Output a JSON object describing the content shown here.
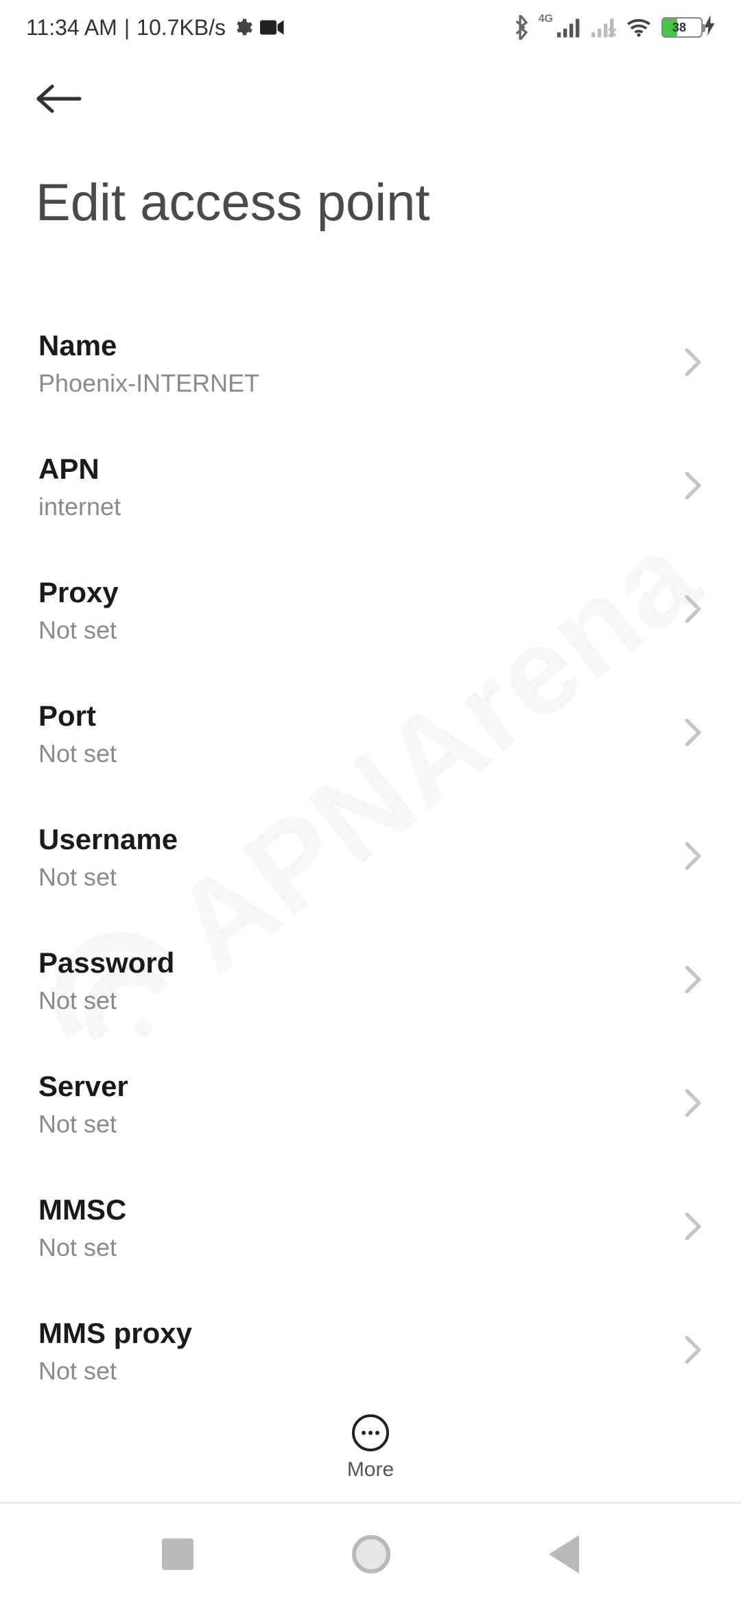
{
  "status_bar": {
    "time": "11:34 AM",
    "separator": "|",
    "net_speed": "10.7KB/s",
    "icons": {
      "gear": "gear-icon",
      "camera": "camera-icon",
      "bluetooth": "bluetooth-icon",
      "net_badge": "4G",
      "signal1": "signal-strong-icon",
      "signal2": "signal-none-icon",
      "wifi": "wifi-icon"
    },
    "battery": {
      "level_text": "38",
      "level_pct": 38,
      "charging": true
    }
  },
  "nav": {
    "back": "back"
  },
  "page": {
    "title": "Edit access point"
  },
  "settings": [
    {
      "key": "name",
      "label": "Name",
      "value": "Phoenix-INTERNET"
    },
    {
      "key": "apn",
      "label": "APN",
      "value": "internet"
    },
    {
      "key": "proxy",
      "label": "Proxy",
      "value": "Not set"
    },
    {
      "key": "port",
      "label": "Port",
      "value": "Not set"
    },
    {
      "key": "username",
      "label": "Username",
      "value": "Not set"
    },
    {
      "key": "password",
      "label": "Password",
      "value": "Not set"
    },
    {
      "key": "server",
      "label": "Server",
      "value": "Not set"
    },
    {
      "key": "mmsc",
      "label": "MMSC",
      "value": "Not set"
    },
    {
      "key": "mms_proxy",
      "label": "MMS proxy",
      "value": "Not set"
    }
  ],
  "footer": {
    "more_label": "More"
  },
  "watermark": {
    "text": "APNArena"
  },
  "system_nav": {
    "recent": "recent-apps",
    "home": "home",
    "back": "back"
  }
}
